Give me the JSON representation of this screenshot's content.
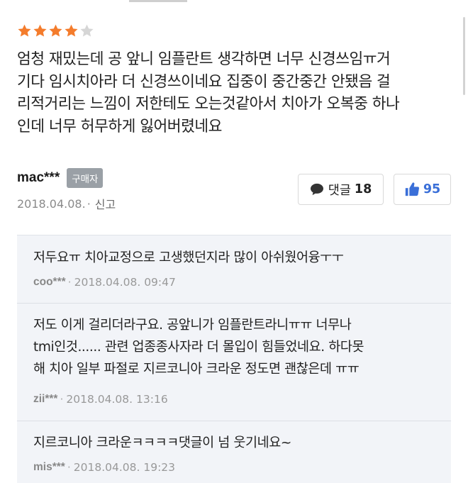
{
  "review": {
    "rating": 4,
    "rating_max": 5,
    "star_color": "#f47c2c",
    "star_empty_color": "#d6d6d6",
    "text_lines": [
      "엄청 재밌는데 공 앞니 임플란트 생각하면 너무 신경쓰임ㅠ거",
      "기다 임시치아라 더 신경쓰이네요 집중이 중간중간 안됐음 걸",
      "리적거리는 느낌이 저한테도 오는것같아서 치아가 오복중 하나",
      "인데 너무 허무하게 잃어버렸네요"
    ],
    "author": "mac***",
    "buyer_badge": "구매자",
    "date": "2018.04.08.",
    "separator": "·",
    "report_label": "신고",
    "comment_button_label": "댓글",
    "comment_count": "18",
    "like_count": "95",
    "like_color": "#3a6fd8"
  },
  "comments": [
    {
      "text_lines": [
        "저두요ㅠ 치아교정으로 고생했던지라 많이 아쉬웠어융ㅜㅜ"
      ],
      "author": "coo***",
      "separator": "·",
      "datetime": "2018.04.08. 09:47"
    },
    {
      "text_lines": [
        "저도 이게 걸리더라구요. 공앞니가 임플란트라니ㅠㅠ 너무나",
        "tmi인것...... 관련 업종종사자라 더 몰입이 힘들었네요. 하다못",
        "해 치아 일부 파절로 지르코니아 크라운 정도면 괜찮은데 ㅠㅠ"
      ],
      "author": "zii***",
      "separator": "·",
      "datetime": "2018.04.08. 13:16"
    },
    {
      "text_lines": [
        "지르코니아 크라운ㅋㅋㅋㅋ댓글이 넘 웃기네요~"
      ],
      "author": "mis***",
      "separator": "·",
      "datetime": "2018.04.08. 19:23"
    }
  ]
}
